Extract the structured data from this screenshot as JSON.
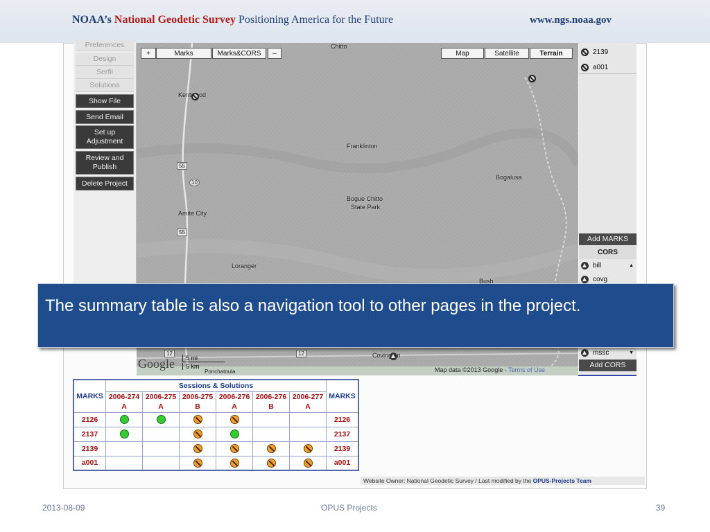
{
  "header": {
    "prefix": "NOAA’s ",
    "brand": "National Geodetic Survey",
    "tagline": " Positioning America for the Future",
    "url": "www.ngs.noaa.gov"
  },
  "nav": {
    "disabled_items": [
      "Preferences",
      "Design",
      "Serfil",
      "Solutions"
    ],
    "buttons": [
      "Show File",
      "Send Email",
      "Set up Adjustment",
      "Review and Publish",
      "Delete Project"
    ]
  },
  "map": {
    "zoom_in": "+",
    "zoom_out": "–",
    "layer_marks": "Marks",
    "layer_marks_cors": "Marks&CORS",
    "type_map": "Map",
    "type_satellite": "Satellite",
    "type_terrain": "Terrain",
    "places": [
      "Chitto",
      "Kentwood",
      "Franklinton",
      "Bogalusa",
      "Bogue Chitto",
      "State Park",
      "Amite City",
      "Loranger",
      "Bush",
      "Covington",
      "Ponchatoula"
    ],
    "highway_labels": [
      "55",
      "10",
      "55",
      "12",
      "12"
    ],
    "scale_mi": "5 mi",
    "scale_km": "5 km",
    "google": "Google",
    "attribution": "Map data ©2013 Google - ",
    "terms": "Terms of Use"
  },
  "marks_panel": {
    "items": [
      "2139",
      "a001"
    ],
    "add_marks": "Add MARKS"
  },
  "cors_panel": {
    "header": "CORS",
    "items": [
      "bill",
      "covg",
      "mssc"
    ],
    "add_cors": "Add CORS"
  },
  "callout": {
    "text": "The summary table is also a navigation tool to other pages in the project."
  },
  "summary_table": {
    "marks_header": "MARKS",
    "group_header": "Sessions & Solutions",
    "sessions": [
      {
        "id": "2006-274",
        "sol": "A"
      },
      {
        "id": "2006-275",
        "sol": "A"
      },
      {
        "id": "2006-275",
        "sol": "B"
      },
      {
        "id": "2006-276",
        "sol": "A"
      },
      {
        "id": "2006-276",
        "sol": "B"
      },
      {
        "id": "2006-277",
        "sol": "A"
      }
    ],
    "rows": [
      {
        "mark": "2126",
        "cells": [
          "green",
          "green",
          "orange",
          "orange",
          "",
          ""
        ]
      },
      {
        "mark": "2137",
        "cells": [
          "green",
          "",
          "orange",
          "green",
          "",
          ""
        ]
      },
      {
        "mark": "2139",
        "cells": [
          "",
          "",
          "orange",
          "orange",
          "orange",
          "orange"
        ]
      },
      {
        "mark": "a001",
        "cells": [
          "",
          "",
          "orange",
          "orange",
          "orange",
          "orange"
        ]
      }
    ]
  },
  "website_footer": {
    "text": "Website Owner: National Geodetic Survey  /  Last modified by the ",
    "team": "OPUS-Projects Team"
  },
  "slide_footer": {
    "date": "2013-08-09",
    "title": "OPUS Projects",
    "page": "39"
  }
}
